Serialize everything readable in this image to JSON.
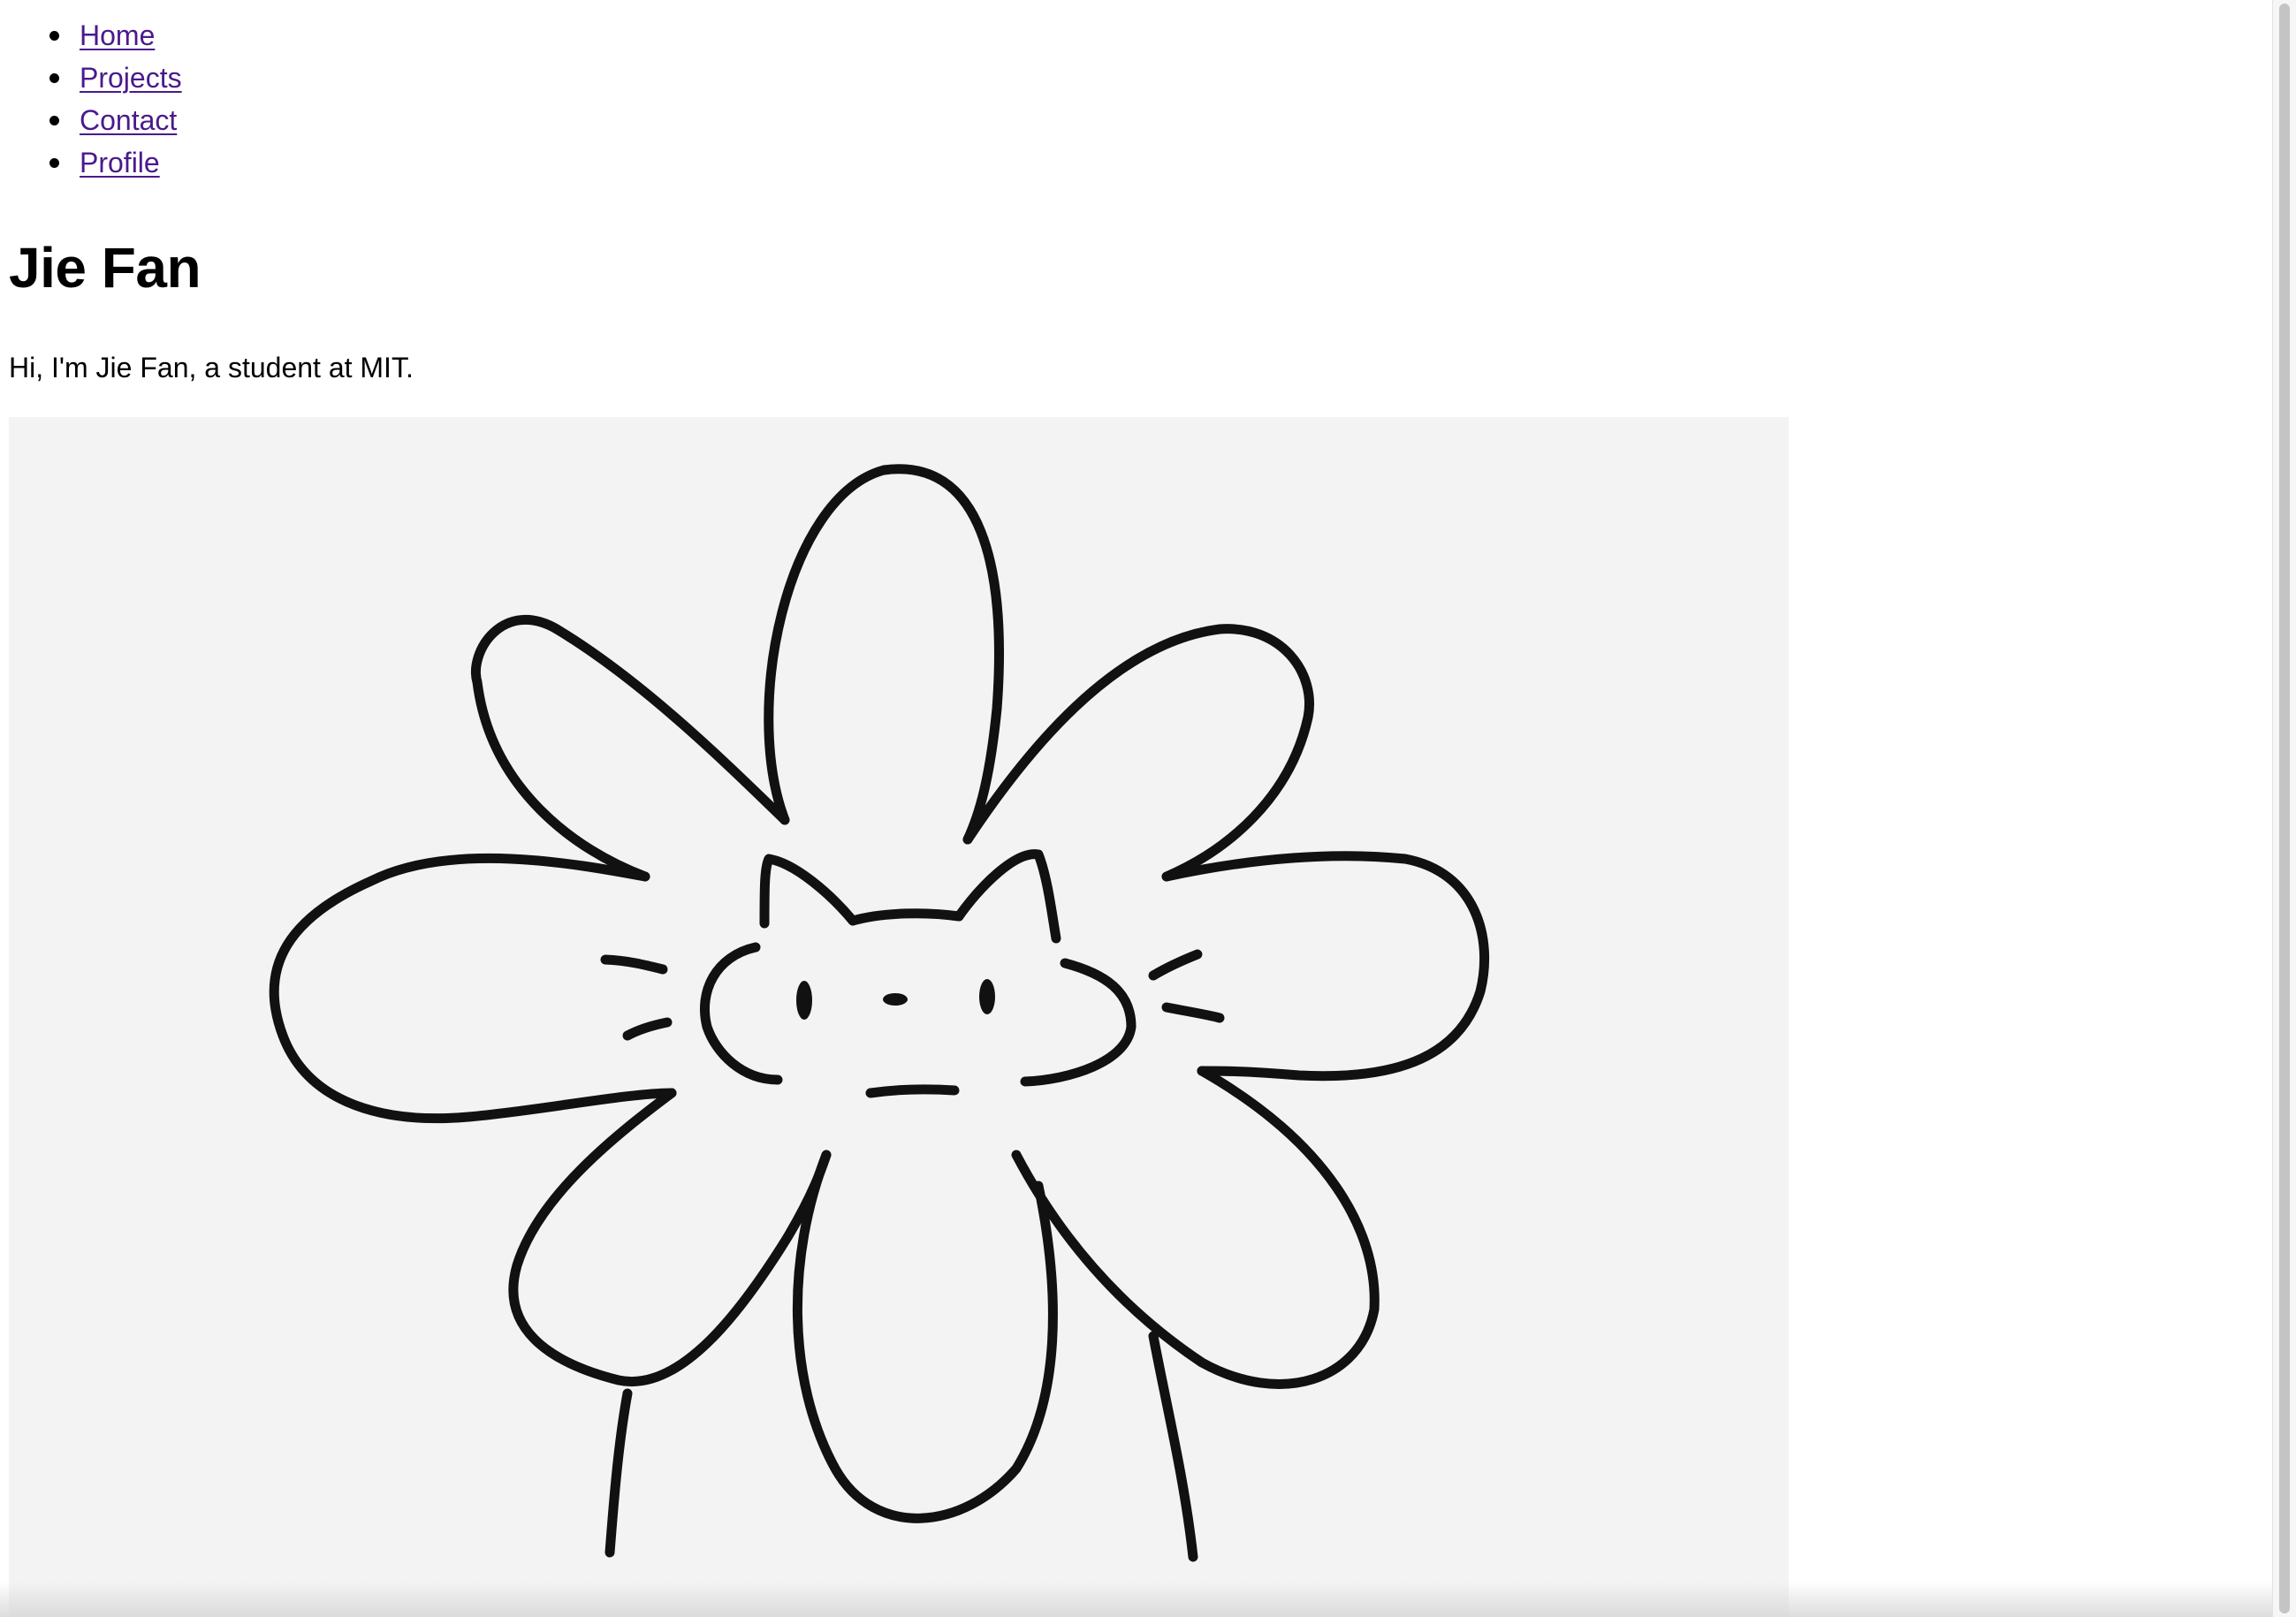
{
  "nav": {
    "items": [
      {
        "label": "Home"
      },
      {
        "label": "Projects"
      },
      {
        "label": "Contact"
      },
      {
        "label": "Profile"
      }
    ],
    "link_color": "#4a1a8c"
  },
  "heading": {
    "title": "Jie Fan"
  },
  "intro": {
    "text": "Hi, I'm Jie Fan, a student at MIT."
  },
  "image": {
    "subject": "cat-flower-drawing",
    "background_color": "#f3f3f3"
  }
}
